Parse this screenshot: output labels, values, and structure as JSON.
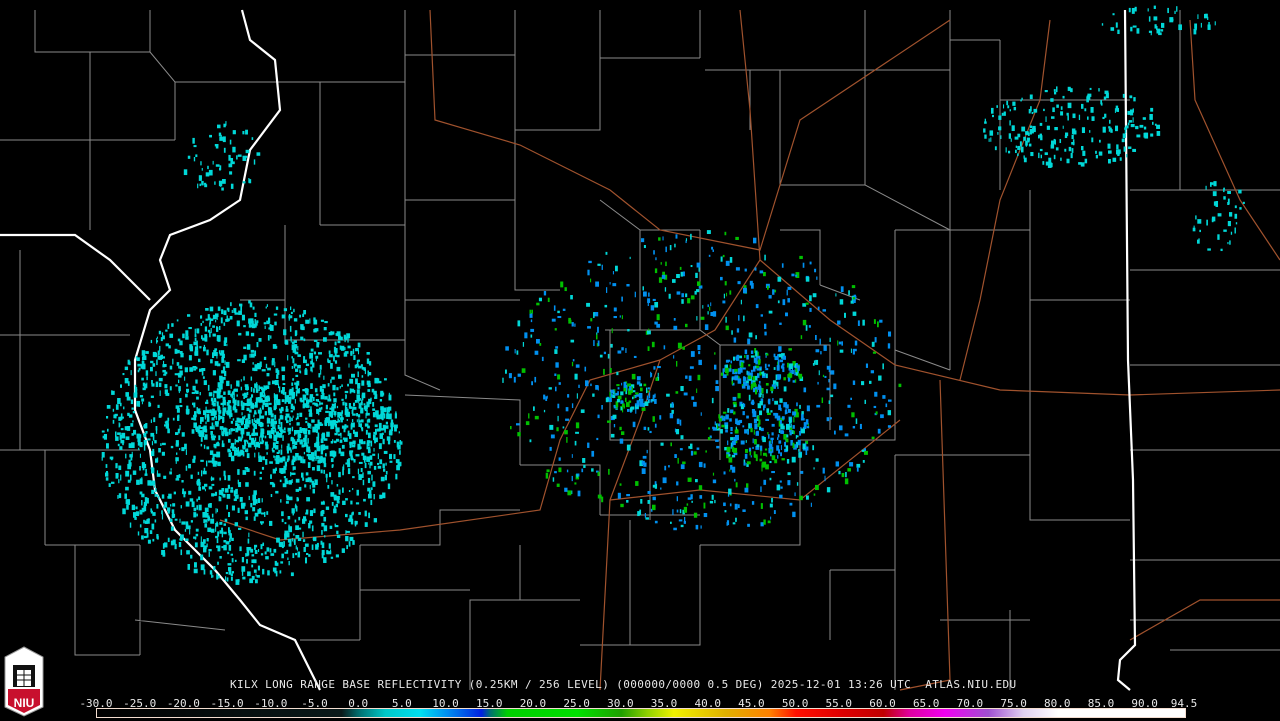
{
  "product_title": "KILX LONG RANGE BASE REFLECTIVITY (0.25KM / 256 LEVEL) (000000/0000 0.5 DEG) 2025-12-01 13:26 UTC  ATLAS.NIU.EDU",
  "logo": {
    "text": "NIU"
  },
  "colorbar": {
    "ticks": [
      "-30.0",
      "-25.0",
      "-20.0",
      "-15.0",
      "-10.0",
      "-5.0",
      "0.0",
      "5.0",
      "10.0",
      "15.0",
      "20.0",
      "25.0",
      "30.0",
      "35.0",
      "40.0",
      "45.0",
      "50.0",
      "55.0",
      "60.0",
      "65.0",
      "70.0",
      "75.0",
      "80.0",
      "85.0",
      "90.0",
      "94.5"
    ],
    "range": [
      -30,
      94.5
    ],
    "stops": [
      {
        "v": -30,
        "c": "#000000"
      },
      {
        "v": -2,
        "c": "#0a1a1a"
      },
      {
        "v": 0,
        "c": "#007070"
      },
      {
        "v": 3,
        "c": "#00c8c8"
      },
      {
        "v": 7,
        "c": "#00e0f0"
      },
      {
        "v": 10,
        "c": "#0090f0"
      },
      {
        "v": 14,
        "c": "#0020e0"
      },
      {
        "v": 15,
        "c": "#007070"
      },
      {
        "v": 17,
        "c": "#00d000"
      },
      {
        "v": 25,
        "c": "#00e000"
      },
      {
        "v": 30,
        "c": "#20a000"
      },
      {
        "v": 33,
        "c": "#90d000"
      },
      {
        "v": 36,
        "c": "#f0f000"
      },
      {
        "v": 42,
        "c": "#e0b000"
      },
      {
        "v": 47,
        "c": "#ff8000"
      },
      {
        "v": 50,
        "c": "#ff1000"
      },
      {
        "v": 55,
        "c": "#e00000"
      },
      {
        "v": 60,
        "c": "#c00000"
      },
      {
        "v": 63,
        "c": "#e000a0"
      },
      {
        "v": 67,
        "c": "#f000f0"
      },
      {
        "v": 72,
        "c": "#a050d0"
      },
      {
        "v": 76,
        "c": "#e0d0f0"
      },
      {
        "v": 80,
        "c": "#ffffff"
      },
      {
        "v": 94.5,
        "c": "#ffffff"
      }
    ]
  },
  "colors": {
    "county": "#8a8a8a",
    "state": "#ffffff",
    "road": "#a0522d",
    "echo_low": "#00d8d8",
    "echo_mid": "#0090f0",
    "echo_high": "#00c000"
  }
}
